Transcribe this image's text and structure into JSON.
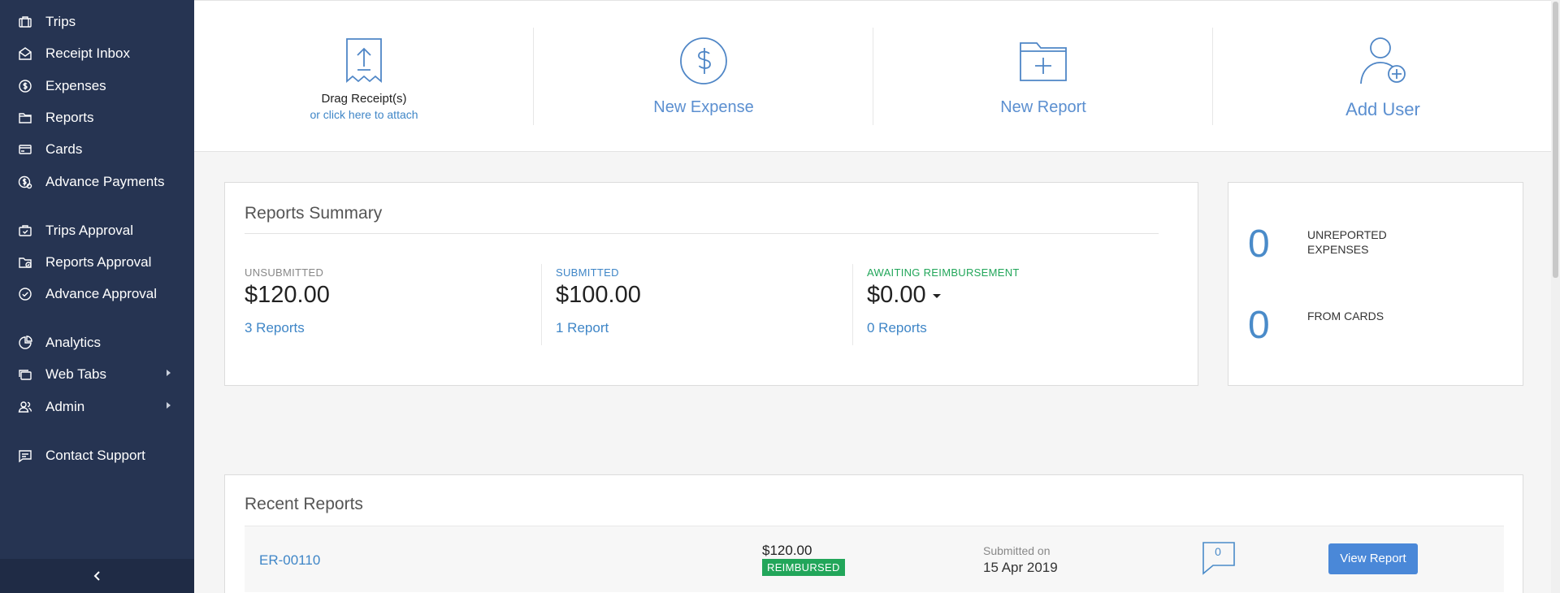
{
  "sidebar": {
    "items": [
      {
        "label": "Trips",
        "icon": "briefcase-icon"
      },
      {
        "label": "Receipt Inbox",
        "icon": "inbox-icon"
      },
      {
        "label": "Expenses",
        "icon": "dollar-circle-icon"
      },
      {
        "label": "Reports",
        "icon": "folder-icon"
      },
      {
        "label": "Cards",
        "icon": "card-icon"
      },
      {
        "label": "Advance Payments",
        "icon": "advance-payment-icon"
      },
      {
        "label": "Trips Approval",
        "icon": "briefcase-check-icon"
      },
      {
        "label": "Reports Approval",
        "icon": "folder-check-icon"
      },
      {
        "label": "Advance Approval",
        "icon": "check-circle-icon"
      },
      {
        "label": "Analytics",
        "icon": "pie-chart-icon"
      },
      {
        "label": "Web Tabs",
        "icon": "tabs-icon"
      },
      {
        "label": "Admin",
        "icon": "users-icon"
      },
      {
        "label": "Contact Support",
        "icon": "chat-icon"
      }
    ]
  },
  "actions": {
    "drag_title": "Drag Receipt(s)",
    "drag_sub": "or click here to attach",
    "new_expense": "New Expense",
    "new_report": "New Report",
    "add_user": "Add User"
  },
  "summary": {
    "title": "Reports Summary",
    "unsubmitted": {
      "caption": "UNSUBMITTED",
      "amount": "$120.00",
      "count": "3 Reports",
      "color": "#888888"
    },
    "submitted": {
      "caption": "SUBMITTED",
      "amount": "$100.00",
      "count": "1 Report",
      "color": "#3f86c7"
    },
    "awaiting": {
      "caption": "AWAITING REIMBURSEMENT",
      "amount": "$0.00",
      "count": "0 Reports",
      "color": "#22a65a"
    }
  },
  "side": {
    "unreported_count": "0",
    "unreported_label_1": "UNREPORTED",
    "unreported_label_2": "EXPENSES",
    "cards_count": "0",
    "cards_label": "FROM CARDS"
  },
  "recent": {
    "title": "Recent Reports",
    "rows": [
      {
        "id": "ER-00110",
        "amount": "$120.00",
        "status": "REIMBURSED",
        "submitted_label": "Submitted on",
        "date": "15 Apr 2019",
        "comments": "0",
        "button": "View Report"
      }
    ]
  }
}
